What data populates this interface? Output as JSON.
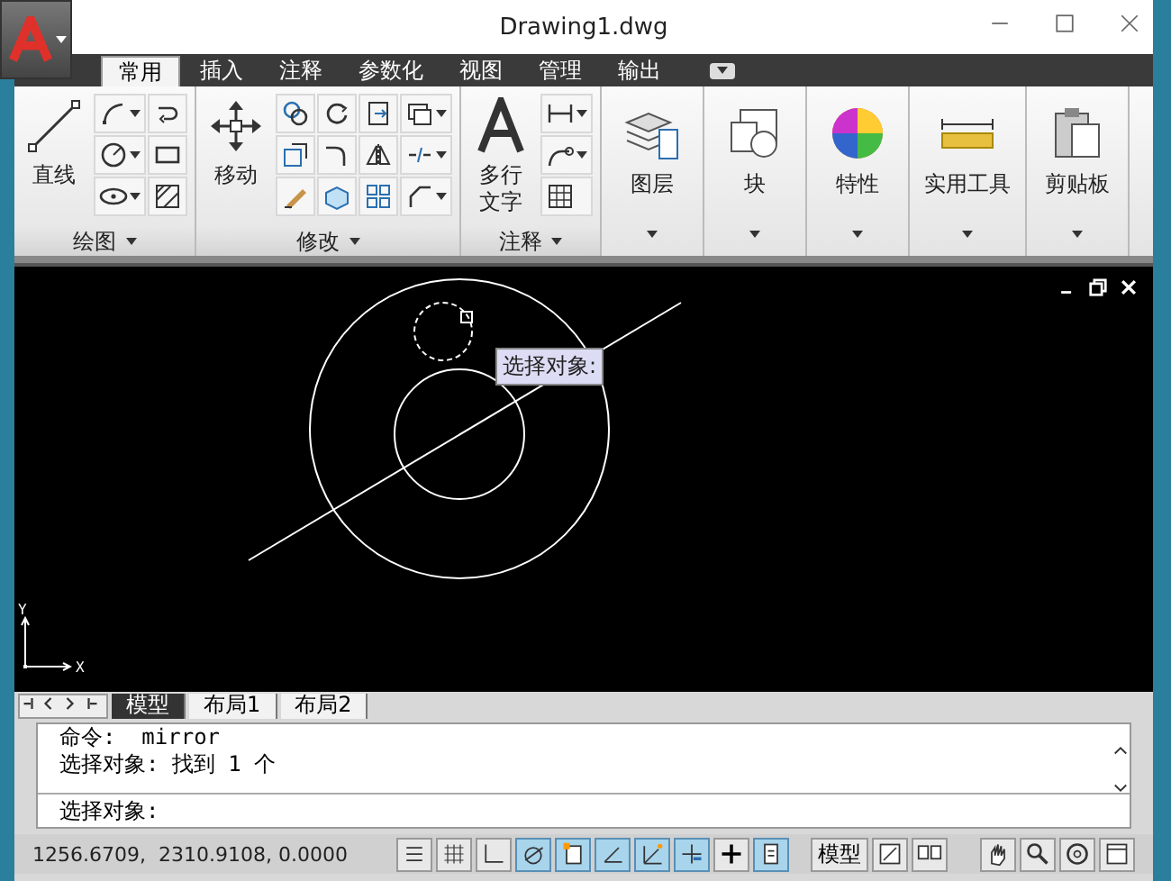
{
  "window": {
    "title": "Drawing1.dwg"
  },
  "tabs": [
    {
      "label": "常用",
      "selected": true
    },
    {
      "label": "插入",
      "selected": false
    },
    {
      "label": "注释",
      "selected": false
    },
    {
      "label": "参数化",
      "selected": false
    },
    {
      "label": "视图",
      "selected": false
    },
    {
      "label": "管理",
      "selected": false
    },
    {
      "label": "输出",
      "selected": false
    }
  ],
  "panels": [
    {
      "kind": "draw",
      "title": "绘图",
      "big": "直线"
    },
    {
      "kind": "modify",
      "title": "修改",
      "big": "移动"
    },
    {
      "kind": "annotate",
      "title": "注释",
      "big": "多行文字"
    },
    {
      "kind": "layers",
      "big": "图层"
    },
    {
      "kind": "block",
      "big": "块"
    },
    {
      "kind": "properties",
      "big": "特性"
    },
    {
      "kind": "utilities",
      "big": "实用工具"
    },
    {
      "kind": "clipboard",
      "big": "剪贴板"
    }
  ],
  "viewport": {
    "tooltip": "选择对象:",
    "axis_x": "X",
    "axis_y": "Y"
  },
  "layout_tabs": [
    {
      "label": "模型",
      "selected": true
    },
    {
      "label": "布局1",
      "selected": false
    },
    {
      "label": "布局2",
      "selected": false
    }
  ],
  "command": {
    "history": [
      "命令:  mirror",
      "选择对象: 找到 1 个"
    ],
    "prompt": "选择对象:"
  },
  "status_bar": {
    "coordinates": "1256.6709,  2310.9108, 0.0000",
    "toggles": [
      {
        "on": false
      },
      {
        "on": false
      },
      {
        "on": false
      },
      {
        "on": true
      },
      {
        "on": true
      },
      {
        "on": true
      },
      {
        "on": true
      },
      {
        "on": true
      },
      {
        "on": false
      },
      {
        "on": true
      }
    ],
    "space": "模型"
  }
}
